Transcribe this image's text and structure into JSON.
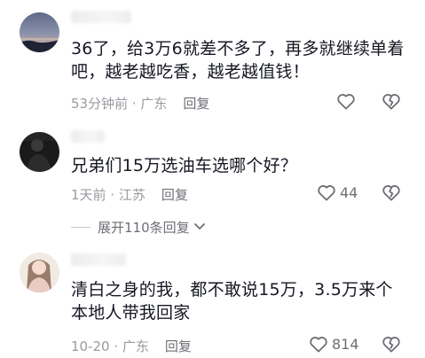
{
  "comments": [
    {
      "text": "36了，给3万6就差不多了，再多就继续单着吧，越老越吃香，越老越值钱！",
      "time_location": "53分钟前 · 广东",
      "reply_label": "回复",
      "like_count": "",
      "avatar_icon": "avatar-dusk-landscape"
    },
    {
      "text": "兄弟们15万选油车选哪个好？",
      "time_location": "1天前 · 江苏",
      "reply_label": "回复",
      "like_count": "44",
      "avatar_icon": "avatar-dark-silhouette"
    },
    {
      "text": "清白之身的我，都不敢说15万，3.5万来个本地人带我回家",
      "time_location": "10-20 · 广东",
      "reply_label": "回复",
      "like_count": "814",
      "avatar_icon": "avatar-woman-photo"
    }
  ],
  "expand_replies_label": "展开110条回复",
  "icons": {
    "like": "heart-outline-icon",
    "dislike": "broken-heart-icon",
    "expand": "chevron-down-icon"
  },
  "colors": {
    "text_primary": "#161823",
    "text_meta": "#9a9ba1",
    "reply": "#6e6f75",
    "icon": "#6e6f75"
  }
}
